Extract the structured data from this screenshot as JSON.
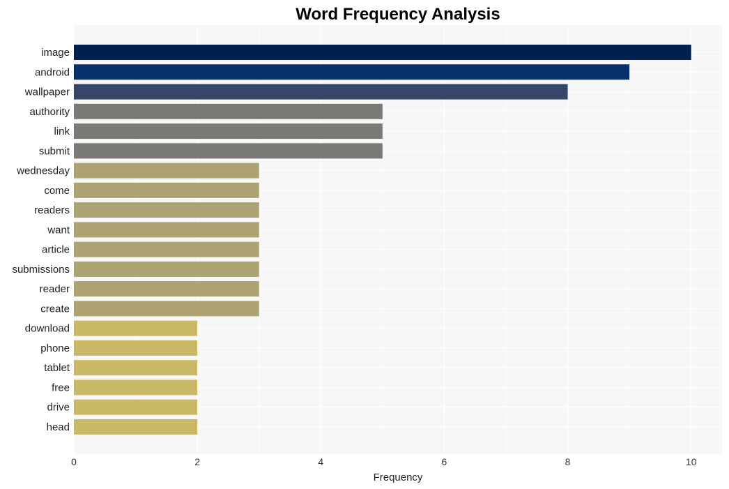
{
  "chart_data": {
    "type": "bar",
    "orientation": "horizontal",
    "title": "Word Frequency Analysis",
    "xlabel": "Frequency",
    "ylabel": "",
    "xlim": [
      0,
      10.5
    ],
    "xticks": [
      0,
      2,
      4,
      6,
      8,
      10
    ],
    "grid": true,
    "legend": "none",
    "categories": [
      "image",
      "android",
      "wallpaper",
      "authority",
      "link",
      "submit",
      "wednesday",
      "come",
      "readers",
      "want",
      "article",
      "submissions",
      "reader",
      "create",
      "download",
      "phone",
      "tablet",
      "free",
      "drive",
      "head"
    ],
    "values": [
      10,
      9,
      8,
      5,
      5,
      5,
      3,
      3,
      3,
      3,
      3,
      3,
      3,
      3,
      2,
      2,
      2,
      2,
      2,
      2
    ],
    "colors": [
      "#00204e",
      "#08306b",
      "#36466b",
      "#7b7a77",
      "#7b7a77",
      "#7b7a77",
      "#ada271",
      "#ada271",
      "#ada271",
      "#ada271",
      "#ada271",
      "#ada271",
      "#ada271",
      "#ada271",
      "#c9b866",
      "#c9b866",
      "#c9b866",
      "#c9b866",
      "#c9b866",
      "#c9b866"
    ],
    "plot_background": "#f7f7f7"
  }
}
